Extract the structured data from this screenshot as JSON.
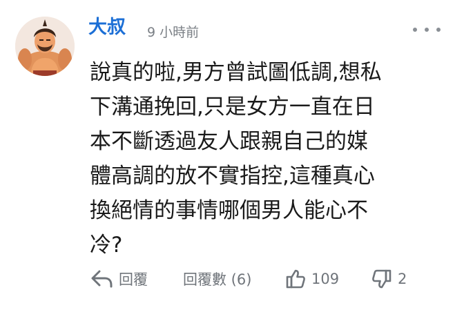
{
  "comment": {
    "author": "大叔",
    "time": "9 小時前",
    "text": "說真的啦,男方曾試圖低調,想私\n下溝通挽回,只是女方一直在日\n本不斷透過友人跟親自己的媒\n體高調的放不實指控,這種真心\n換絕情的事情哪個男人能心不\n冷?"
  },
  "actions": {
    "reply_label": "回覆",
    "replies_label": "回覆數 (6)",
    "like_count": "109",
    "dislike_count": "2"
  },
  "icons": {
    "avatar": "avatar-image",
    "more": "more-horizontal-icon",
    "reply": "reply-arrow-icon",
    "like": "thumbs-up-icon",
    "dislike": "thumbs-down-icon"
  },
  "colors": {
    "author": "#1c6fd6",
    "meta": "#7a7f85",
    "text": "#1a1a1a"
  }
}
